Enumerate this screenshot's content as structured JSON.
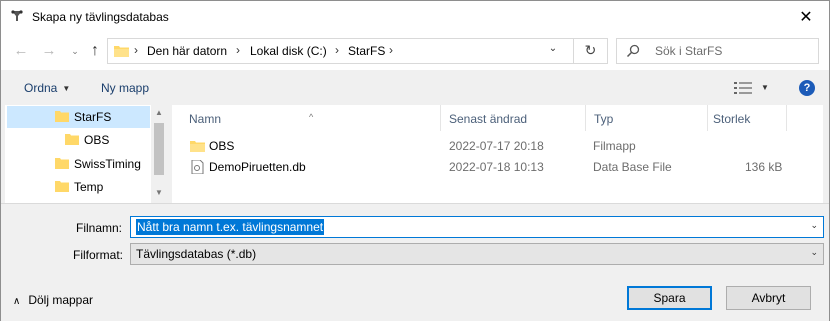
{
  "window": {
    "title": "Skapa ny tävlingsdatabas",
    "close_label": "✕"
  },
  "navigation": {
    "back_label": "←",
    "forward_label": "→",
    "recent_label": "⌄",
    "up_label": "↑",
    "breadcrumbs": [
      "Den här datorn",
      "Lokal disk (C:)",
      "StarFS"
    ],
    "breadcrumb_separator": "›",
    "dropdown_label": "⌄",
    "refresh_label": "↻",
    "search_placeholder": "Sök i StarFS"
  },
  "toolbar": {
    "organize_label": "Ordna",
    "organize_caret": "▼",
    "new_folder_label": "Ny mapp",
    "view_caret": "▼",
    "help_label": "?"
  },
  "nav_pane": {
    "items": [
      {
        "label": "StarFS",
        "selected": true
      },
      {
        "label": "OBS"
      },
      {
        "label": "SwissTiming"
      },
      {
        "label": "Temp"
      }
    ],
    "scroll_up": "▲",
    "scroll_down": "▼"
  },
  "file_list": {
    "sort_indicator": "^",
    "columns": {
      "name": "Namn",
      "date": "Senast ändrad",
      "type": "Typ",
      "size": "Storlek"
    },
    "rows": [
      {
        "name": "OBS",
        "date": "2022-07-17 20:18",
        "type": "Filmapp",
        "size": "",
        "icon": "folder-icon"
      },
      {
        "name": "DemoPiruetten.db",
        "date": "2022-07-18 10:13",
        "type": "Data Base File",
        "size": "136 kB",
        "icon": "file-icon"
      }
    ]
  },
  "form": {
    "filename_label": "Filnamn:",
    "filename_value": "Nått bra namn t.ex. tävlingsnamnet",
    "filetype_label": "Filformat:",
    "filetype_value": "Tävlingsdatabas (*.db)",
    "caret": "⌄",
    "hide_folders_label": "Dölj mappar",
    "hide_folders_chevron": "∧",
    "save_label": "Spara",
    "cancel_label": "Avbryt"
  },
  "colors": {
    "accent": "#0078d7",
    "selection": "#cce8ff",
    "folder": "#ffd868",
    "help": "#1c5bb8"
  }
}
